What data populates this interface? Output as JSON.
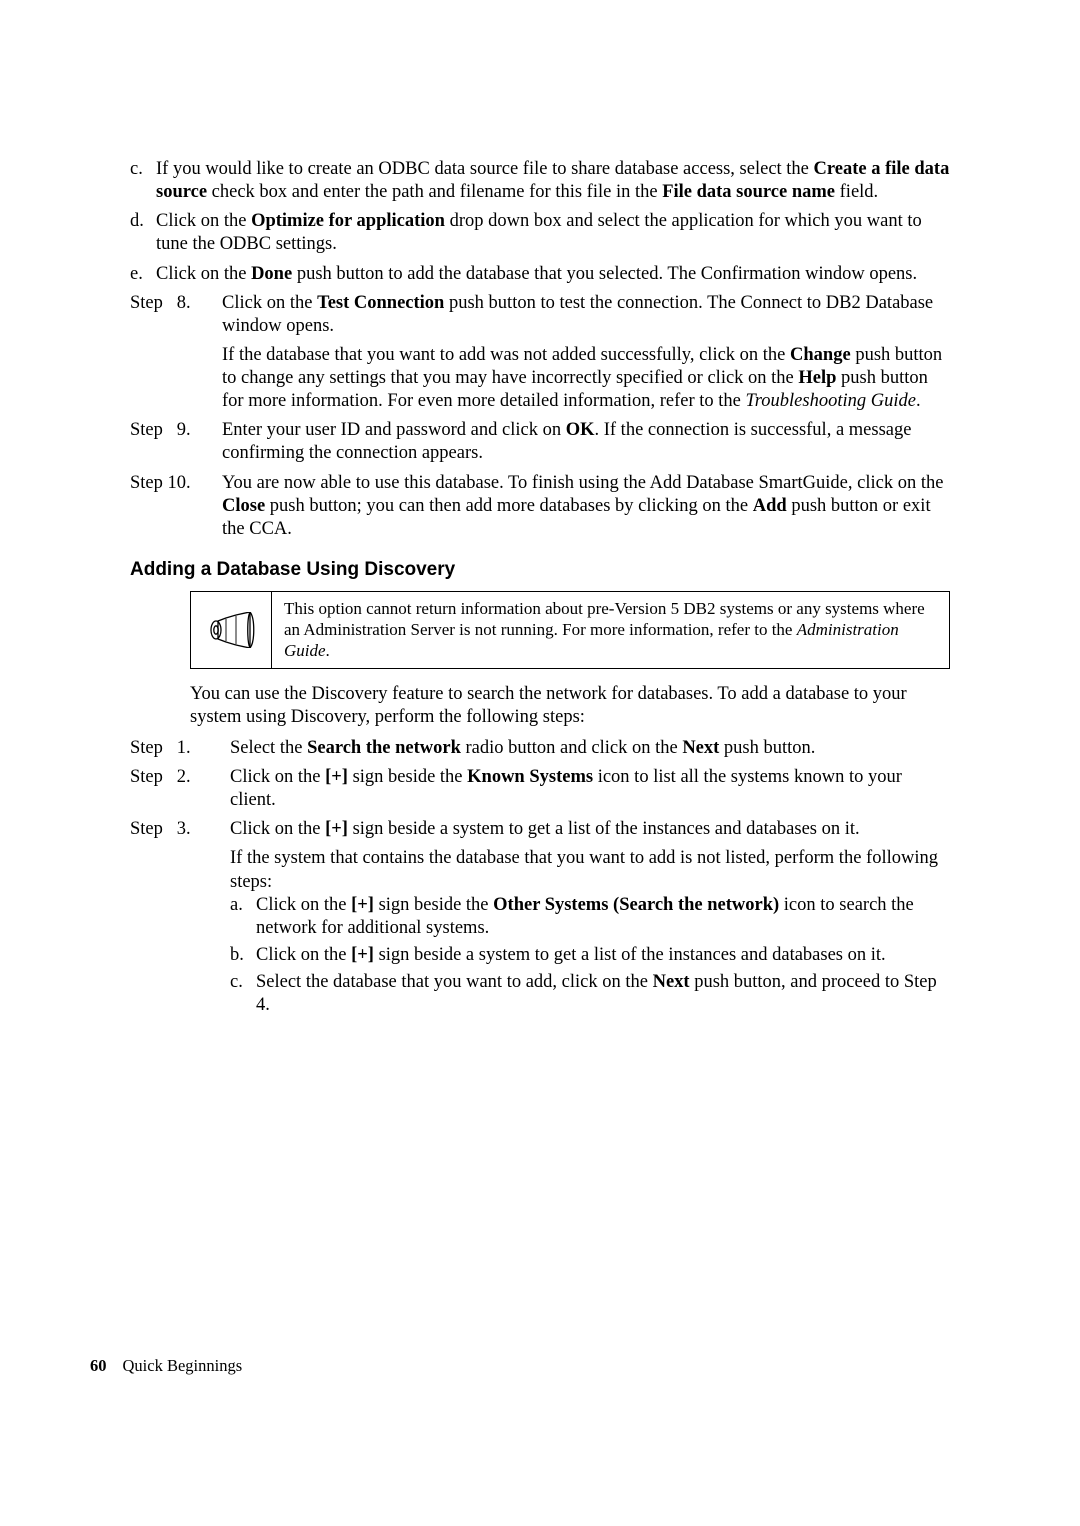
{
  "steps_top": {
    "sub_c": {
      "marker": "c.",
      "t1": "If you would like to create an ODBC data source file to share database access, select the ",
      "b1": "Create a file data source",
      "t2": " check box and enter the path and filename for this file in the ",
      "b2": "File data source name",
      "t3": " field."
    },
    "sub_d": {
      "marker": "d.",
      "t1": "Click on the ",
      "b1": "Optimize for application",
      "t2": " drop down box and select the application for which you want to tune the ODBC settings."
    },
    "sub_e": {
      "marker": "e.",
      "t1": "Click on the ",
      "b1": "Done",
      "t2": " push button to add the database that you selected. The Confirmation window opens."
    },
    "step8": {
      "marker": "Step   8.",
      "p1a": "Click on the ",
      "p1b": "Test Connection",
      "p1c": " push button to test the connection. The Connect to DB2 Database window opens.",
      "p2a": "If the database that you want to add was not added successfully, click on the ",
      "p2b": "Change",
      "p2c": " push button to change any settings that you may have incorrectly specified or click on the ",
      "p2d": "Help",
      "p2e": " push button for more information. For even more detailed information, refer to the ",
      "p2i": "Troubleshooting Guide",
      "p2f": "."
    },
    "step9": {
      "marker": "Step   9.",
      "t1": "Enter your user ID and password and click on ",
      "b1": "OK",
      "t2": ". If the connection is successful, a message confirming the connection appears."
    },
    "step10": {
      "marker": "Step 10.",
      "t1": "You are now able to use this database. To finish using the Add Database SmartGuide, click on the ",
      "b1": "Close",
      "t2": " push button; you can then add more databases by clicking on the ",
      "b2": "Add",
      "t3": " push button or exit the CCA."
    }
  },
  "section_heading": "Adding a Database Using Discovery",
  "note": {
    "t1": "This option cannot return information about pre-Version 5 DB2 systems or any systems where an Administration Server is not running. For more information, refer to the ",
    "i1": "Administration Guide",
    "t2": "."
  },
  "intro": "You can use the Discovery feature to search the network for databases. To add a database to your system using Discovery, perform the following steps:",
  "steps_bottom": {
    "s1": {
      "marker": "Step   1.",
      "t1": "Select the ",
      "b1": "Search the network",
      "t2": " radio button and click on the ",
      "b2": "Next",
      "t3": " push button."
    },
    "s2": {
      "marker": "Step   2.",
      "t1": "Click on the ",
      "b1": "[+]",
      "t2": " sign beside the ",
      "b2": "Known Systems",
      "t3": " icon to list all the systems known to your client."
    },
    "s3": {
      "marker": "Step   3.",
      "p1a": "Click on the ",
      "p1b": "[+]",
      "p1c": " sign beside a system to get a list of the instances and databases on it.",
      "p2": "If the system that contains the database that you want to add is not listed, perform the following steps:",
      "a": {
        "marker": "a.",
        "t1": "Click on the ",
        "b1": "[+]",
        "t2": " sign beside the ",
        "b2": "Other Systems (Search the network)",
        "t3": " icon to search the network for additional systems."
      },
      "b": {
        "marker": "b.",
        "t1": "Click on the ",
        "b1": "[+]",
        "t2": " sign beside a system to get a list of the instances and databases on it."
      },
      "c": {
        "marker": "c.",
        "t1": "Select the database that you want to add, click on the ",
        "b1": "Next",
        "t2": " push button, and proceed to Step 4."
      }
    }
  },
  "footer": {
    "page_number": "60",
    "running_head": "Quick Beginnings"
  }
}
